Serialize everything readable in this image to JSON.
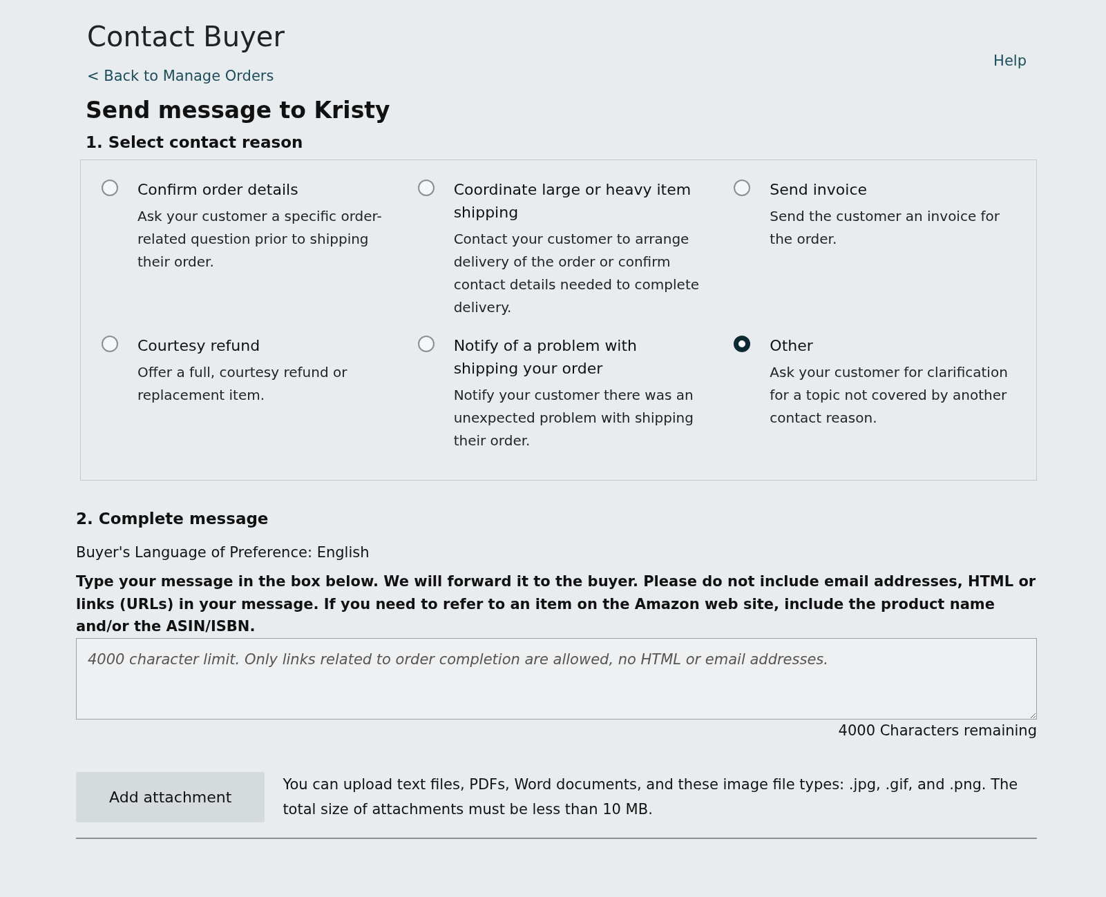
{
  "page": {
    "title": "Contact Buyer",
    "back_link": "< Back to Manage Orders",
    "help_link": "Help"
  },
  "heading": "Send message to Kristy",
  "step_1": {
    "title": "1. Select contact reason",
    "reasons": [
      {
        "label": "Confirm order details",
        "description": "Ask your customer a specific order-related question prior to shipping their order.",
        "selected": false
      },
      {
        "label": "Coordinate large or heavy item shipping",
        "description": "Contact your customer to arrange delivery of the order or confirm contact details needed to complete delivery.",
        "selected": false
      },
      {
        "label": "Send invoice",
        "description": "Send the customer an invoice for the order.",
        "selected": false
      },
      {
        "label": "Courtesy refund",
        "description": "Offer a full, courtesy refund or replacement item.",
        "selected": false
      },
      {
        "label": "Notify of a problem with shipping your order",
        "description": "Notify your customer there was an unexpected problem with shipping their order.",
        "selected": false
      },
      {
        "label": "Other",
        "description": "Ask your customer for clarification for a topic not covered by another contact reason.",
        "selected": true
      }
    ]
  },
  "step_2": {
    "title": "2. Complete message",
    "language": "Buyer's Language of Preference: English",
    "instructions": "Type your message in the box below. We will forward it to the buyer. Please do not include email addresses, HTML or links (URLs) in your message. If you need to refer to an item on the Amazon web site, include the product name and/or the ASIN/ISBN.",
    "message": {
      "placeholder": "4000 character limit. Only links related to order completion are allowed, no HTML or email addresses."
    },
    "counter": "4000 Characters remaining",
    "attachment_button": "Add attachment",
    "attachment_note": "You can upload text files, PDFs, Word documents, and these image file types: .jpg, .gif, and .png. The total size of attachments must be less than 10 MB."
  }
}
